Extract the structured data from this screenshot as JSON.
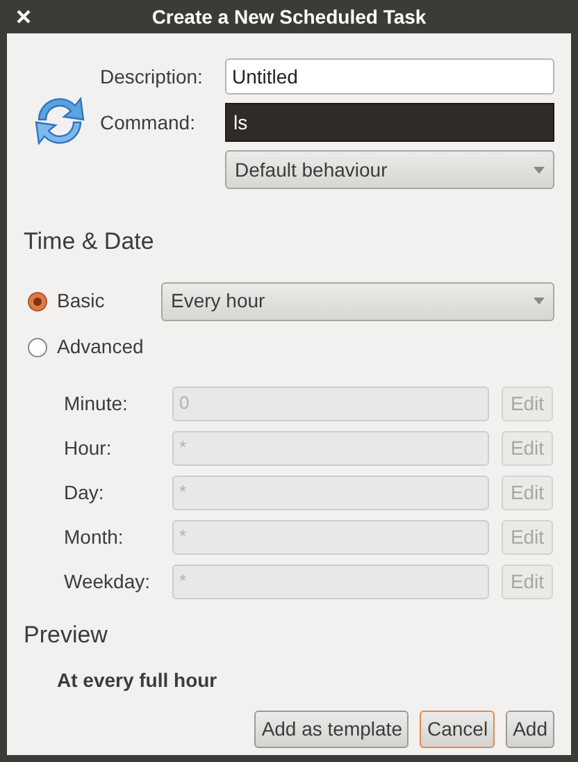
{
  "window": {
    "title": "Create a New Scheduled Task"
  },
  "description": {
    "label": "Description:",
    "value": "Untitled"
  },
  "command": {
    "label": "Command:",
    "value": "ls",
    "focused": true
  },
  "behaviour_dropdown": {
    "value": "Default behaviour"
  },
  "time_date": {
    "heading": "Time & Date",
    "modes": [
      {
        "label": "Basic",
        "selected": true,
        "dropdown": "Every hour"
      },
      {
        "label": "Advanced",
        "selected": false
      }
    ],
    "fields": [
      {
        "label": "Minute:",
        "value": "0",
        "disabled": true,
        "button": "Edit"
      },
      {
        "label": "Hour:",
        "value": "*",
        "disabled": true,
        "button": "Edit"
      },
      {
        "label": "Day:",
        "value": "*",
        "disabled": true,
        "button": "Edit"
      },
      {
        "label": "Month:",
        "value": "*",
        "disabled": true,
        "button": "Edit"
      },
      {
        "label": "Weekday:",
        "value": "*",
        "disabled": true,
        "button": "Edit"
      }
    ]
  },
  "preview": {
    "heading": "Preview",
    "text": "At every full hour"
  },
  "buttons": [
    {
      "label": "Add as template",
      "focused": false
    },
    {
      "label": "Cancel",
      "focused": true
    },
    {
      "label": "Add",
      "focused": false
    }
  ]
}
